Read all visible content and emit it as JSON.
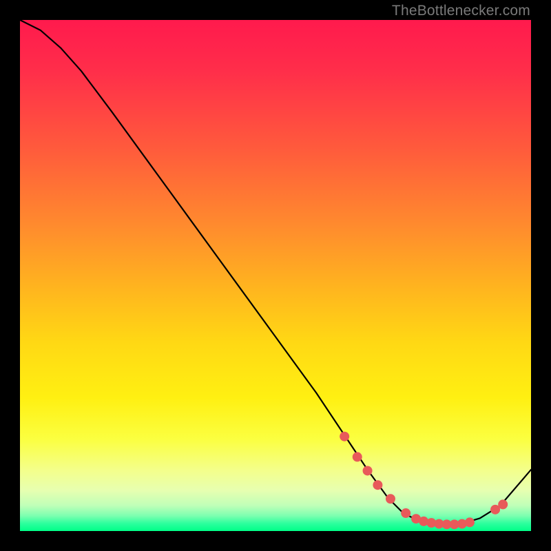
{
  "watermark": "TheBottlenecker.com",
  "colors": {
    "dot": "#e85a5a",
    "line": "#000000"
  },
  "chart_data": {
    "type": "line",
    "title": "",
    "xlabel": "",
    "ylabel": "",
    "xlim": [
      0,
      100
    ],
    "ylim": [
      0,
      100
    ],
    "grid": false,
    "series": [
      {
        "name": "bottleneck-curve",
        "x": [
          0,
          4,
          8,
          12,
          18,
          26,
          34,
          42,
          50,
          58,
          64,
          68,
          72,
          75,
          78,
          82,
          86,
          90,
          94,
          100
        ],
        "y": [
          100,
          98,
          94.5,
          90,
          82,
          71,
          60,
          49,
          38,
          27,
          18,
          12,
          6.5,
          3.5,
          2,
          1.3,
          1.3,
          2.5,
          5,
          12
        ]
      }
    ],
    "markers": {
      "name": "highlight-dots",
      "x": [
        63.5,
        66,
        68,
        70,
        72.5,
        75.5,
        77.5,
        79,
        80.5,
        82,
        83.5,
        85,
        86.5,
        88,
        93,
        94.5
      ],
      "y": [
        18.5,
        14.5,
        11.8,
        9,
        6.3,
        3.5,
        2.4,
        1.9,
        1.6,
        1.4,
        1.3,
        1.3,
        1.4,
        1.7,
        4.2,
        5.2
      ]
    }
  }
}
